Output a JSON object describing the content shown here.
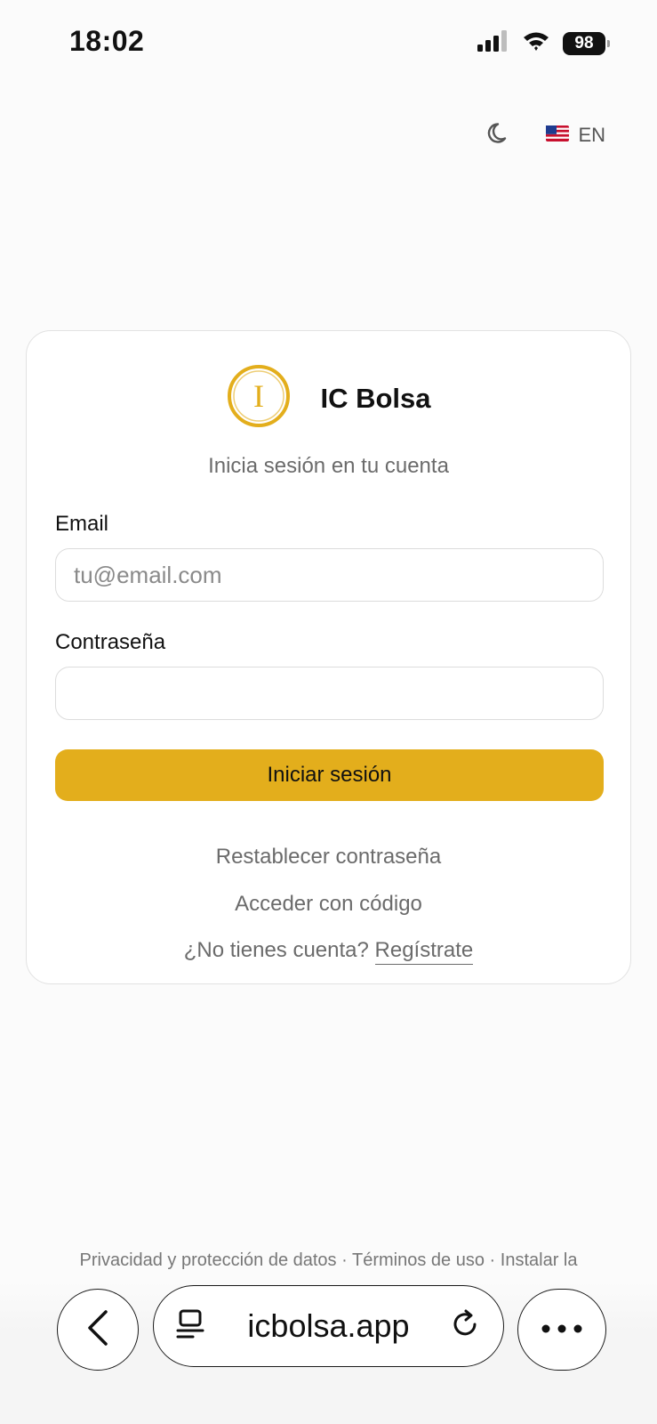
{
  "status_bar": {
    "time": "18:02",
    "battery": "98",
    "icons": [
      "signal-icon",
      "wifi-icon",
      "battery-icon"
    ]
  },
  "top_controls": {
    "theme_icon": "moon-icon",
    "language_flag": "us-flag-icon",
    "language_code": "EN"
  },
  "brand": {
    "logo_letter": "I",
    "name": "IC Bolsa",
    "accent_color": "#e3ae1c"
  },
  "login_form": {
    "subtitle": "Inicia sesión en tu cuenta",
    "email_label": "Email",
    "email_placeholder": "tu@email.com",
    "email_value": "",
    "password_label": "Contraseña",
    "password_value": "",
    "submit_label": "Iniciar sesión",
    "reset_password_link": "Restablecer contraseña",
    "code_login_link": "Acceder con código",
    "no_account_text": "¿No tienes cuenta?",
    "register_link": "Regístrate"
  },
  "footer": {
    "privacy": "Privacidad y protección de datos",
    "separator": "·",
    "terms": "Términos de uso",
    "install": "Instalar la"
  },
  "browser": {
    "url": "icbolsa.app",
    "icons": [
      "back-icon",
      "reader-icon",
      "reload-icon",
      "more-icon"
    ]
  }
}
